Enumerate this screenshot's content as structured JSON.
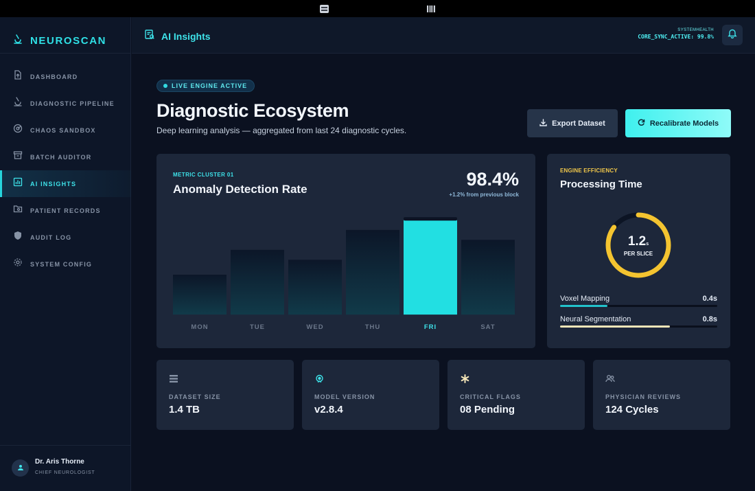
{
  "brand": {
    "name": "NEUROSCAN"
  },
  "nav": [
    {
      "label": "DASHBOARD",
      "icon": "upload-doc-icon",
      "active": false
    },
    {
      "label": "DIAGNOSTIC PIPELINE",
      "icon": "microscope-icon",
      "active": false
    },
    {
      "label": "CHAOS SANDBOX",
      "icon": "radar-icon",
      "active": false
    },
    {
      "label": "BATCH AUDITOR",
      "icon": "archive-icon",
      "active": false
    },
    {
      "label": "AI INSIGHTS",
      "icon": "bar-chart-icon",
      "active": true
    },
    {
      "label": "PATIENT RECORDS",
      "icon": "folder-icon",
      "active": false
    },
    {
      "label": "AUDIT LOG",
      "icon": "shield-icon",
      "active": false
    },
    {
      "label": "SYSTEM CONFIG",
      "icon": "gear-icon",
      "active": false
    }
  ],
  "user": {
    "name": "Dr. Aris Thorne",
    "role": "CHIEF NEUROLOGIST"
  },
  "header": {
    "title": "AI Insights",
    "system_label": "SYSTEMHEALTH",
    "system_value": "CORE_SYNC_ACTIVE: 99.8%"
  },
  "page": {
    "badge": "LIVE ENGINE ACTIVE",
    "title": "Diagnostic Ecosystem",
    "subtitle": "Deep learning analysis — aggregated from last 24 diagnostic cycles.",
    "export_label": "Export Dataset",
    "recalibrate_label": "Recalibrate Models"
  },
  "metric": {
    "label": "METRIC CLUSTER 01",
    "title": "Anomaly Detection Rate",
    "value": "98.4%",
    "delta": "+1.2% from previous block"
  },
  "chart_data": {
    "type": "bar",
    "categories": [
      "MON",
      "TUE",
      "WED",
      "THU",
      "FRI",
      "SAT"
    ],
    "values": [
      40,
      65,
      55,
      85,
      95,
      75
    ],
    "highlight": "FRI",
    "ylim": [
      0,
      100
    ],
    "grid": false,
    "colors": {
      "bar": "#0c1424",
      "highlight": "#22dfe2",
      "tick": "#6b778a",
      "tick_active": "#3ee3ea"
    }
  },
  "efficiency": {
    "label": "ENGINE EFFICIENCY",
    "title": "Processing Time",
    "value": "1.2",
    "value_unit": "s",
    "value_caption": "PER SLICE",
    "gauge_fraction": 0.85,
    "rows": [
      {
        "label": "Voxel Mapping",
        "value": "0.4s",
        "fraction": 0.3,
        "color": "#22c2cc"
      },
      {
        "label": "Neural Segmentation",
        "value": "0.8s",
        "fraction": 0.7,
        "color": "#f5e6b8"
      }
    ]
  },
  "stats": [
    {
      "label": "DATASET SIZE",
      "value": "1.4 TB",
      "icon": "list-icon"
    },
    {
      "label": "MODEL VERSION",
      "value": "v2.8.4",
      "icon": "target-icon"
    },
    {
      "label": "CRITICAL FLAGS",
      "value": "08 Pending",
      "icon": "asterisk-icon"
    },
    {
      "label": "PHYSICIAN REVIEWS",
      "value": "124 Cycles",
      "icon": "users-icon"
    }
  ]
}
